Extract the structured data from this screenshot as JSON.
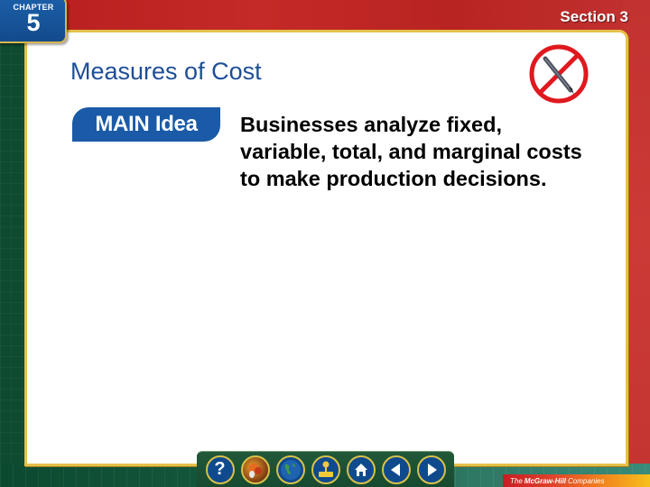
{
  "header": {
    "chapter_label": "CHAPTER",
    "chapter_number": "5",
    "section_label": "Section 3"
  },
  "slide": {
    "title": "Measures of Cost",
    "main_idea_label": "MAIN Idea",
    "main_idea_text": "Businesses analyze fixed, variable, total, and marginal costs to make production decisions.",
    "corner_icon": "no-writing-icon"
  },
  "nav": {
    "buttons": [
      {
        "name": "help-button",
        "icon": "question-mark-icon",
        "glyph": "?"
      },
      {
        "name": "resources-button",
        "icon": "fruit-bowl-icon"
      },
      {
        "name": "web-button",
        "icon": "globe-icon"
      },
      {
        "name": "quiz-button",
        "icon": "joystick-icon"
      },
      {
        "name": "home-button",
        "icon": "home-icon"
      },
      {
        "name": "previous-button",
        "icon": "arrow-left-icon"
      },
      {
        "name": "next-button",
        "icon": "arrow-right-icon"
      }
    ]
  },
  "footer": {
    "publisher_prefix": "The",
    "publisher_name": "McGraw-Hill",
    "publisher_suffix": "Companies"
  },
  "colors": {
    "title_blue": "#1d4e97",
    "badge_blue": "#1a5aa6",
    "frame_gold": "#e6c14a",
    "band_red": "#c42a27",
    "band_green": "#0d4a30"
  }
}
